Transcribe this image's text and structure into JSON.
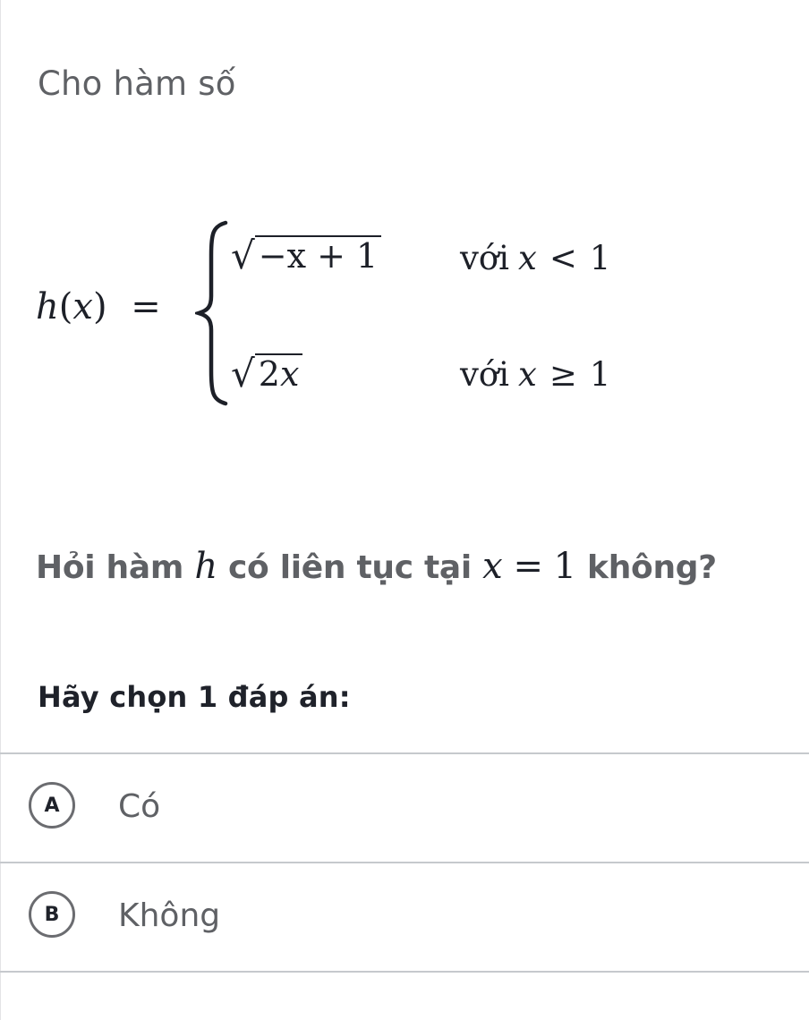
{
  "question": {
    "intro": "Cho hàm số",
    "function": {
      "lhs_name": "h",
      "lhs_arg": "x",
      "cases": [
        {
          "expression": "√(-x + 1)",
          "radicand": "−x + 1",
          "condition_word": "với",
          "condition_var": "x",
          "condition_op": "<",
          "condition_value": "1"
        },
        {
          "expression": "√(2x)",
          "radicand_num": "2",
          "radicand_var": "x",
          "condition_word": "với",
          "condition_var": "x",
          "condition_op": "≥",
          "condition_value": "1"
        }
      ]
    },
    "ask": {
      "part1": "Hỏi hàm",
      "func_name": "h",
      "part2": "có liên tục tại",
      "var": "x",
      "op": "=",
      "value": "1",
      "part3": "không?"
    }
  },
  "answer_prompt": "Hãy chọn 1 đáp án:",
  "options": [
    {
      "letter": "A",
      "label": "Có"
    },
    {
      "letter": "B",
      "label": "Không"
    }
  ]
}
